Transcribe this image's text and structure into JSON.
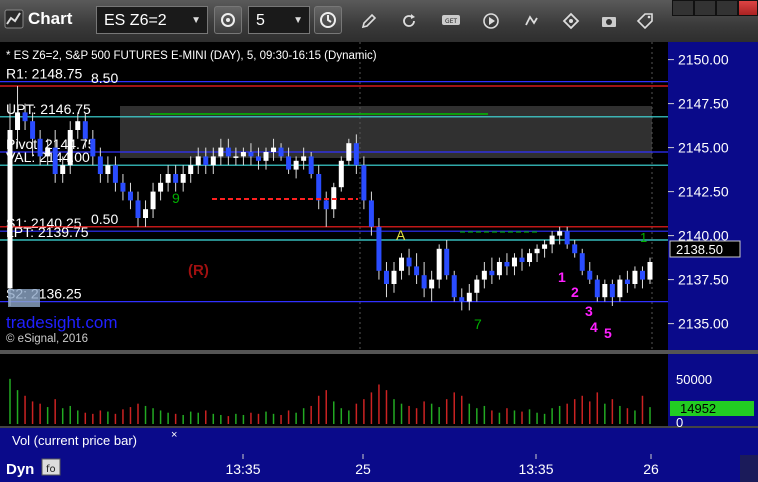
{
  "toolbar": {
    "app_title": "Chart",
    "symbol": "ES Z6=2",
    "interval": "5",
    "icons": [
      "link-icon",
      "interval-clock-icon",
      "pencil-icon",
      "refresh-icon",
      "get-icon",
      "play-icon",
      "diamond-icon",
      "camera-icon",
      "tag-icon"
    ]
  },
  "chart_data": {
    "type": "candlestick",
    "header": "* ES Z6=2, S&P 500 FUTURES E-MINI (DAY), 5, 09:30-16:15 (Dynamic)",
    "ylim": [
      2133.5,
      2151.0
    ],
    "y_ticks": [
      "2150.00",
      "2147.50",
      "2145.00",
      "2142.50",
      "2140.00",
      "2137.50",
      "2135.00"
    ],
    "last_price": "2138.50",
    "x_ticks": [
      "13:35",
      "25",
      "13:35",
      "26"
    ],
    "levels": [
      {
        "label": "R1: 2148.75",
        "value": 2148.75,
        "color": "#3030ff"
      },
      {
        "label": "8.50",
        "value": 2148.5,
        "color": "#ff2020"
      },
      {
        "label": "UPT: 2146.75",
        "value": 2146.75,
        "color": "#40e0e0"
      },
      {
        "label": "Pivot: 2144.75",
        "value": 2144.75,
        "color": "#3030ff"
      },
      {
        "label": "VAL: 2144.00",
        "value": 2144.0,
        "color": "#40e0e0"
      },
      {
        "label": "S1: 2140.25",
        "value": 2140.25,
        "color": "#3030ff"
      },
      {
        "label": "0.50",
        "value": 2140.5,
        "color": "#ff2020"
      },
      {
        "label": "LPT: 2139.75",
        "value": 2139.75,
        "color": "#40e0e0"
      },
      {
        "label": "S2: 2136.25",
        "value": 2136.25,
        "color": "#3030ff"
      }
    ],
    "annotations": {
      "A": "A",
      "R": "(R)",
      "magenta": [
        "1",
        "2",
        "3",
        "4",
        "5"
      ],
      "green_seq": [
        "7",
        "9",
        "1"
      ]
    },
    "watermark": "tradesight.com",
    "copyright": "© eSignal, 2016",
    "volume": {
      "label": "Vol (current price bar)",
      "ticks": [
        "50000",
        "0"
      ],
      "last": "14952"
    },
    "ohlc": [
      [
        2137.0,
        2147.5,
        2136.0,
        2146.0
      ],
      [
        2146.0,
        2148.5,
        2145.0,
        2147.0
      ],
      [
        2147.0,
        2147.5,
        2146.0,
        2146.5
      ],
      [
        2146.5,
        2147.0,
        2144.5,
        2145.5
      ],
      [
        2145.5,
        2146.0,
        2144.0,
        2144.5
      ],
      [
        2144.5,
        2145.5,
        2144.0,
        2145.0
      ],
      [
        2145.0,
        2146.0,
        2143.0,
        2143.5
      ],
      [
        2143.5,
        2144.5,
        2143.0,
        2144.0
      ],
      [
        2144.0,
        2146.5,
        2143.5,
        2146.0
      ],
      [
        2146.0,
        2147.0,
        2145.5,
        2146.5
      ],
      [
        2146.5,
        2147.0,
        2145.0,
        2145.5
      ],
      [
        2145.5,
        2146.0,
        2144.0,
        2144.5
      ],
      [
        2144.5,
        2145.0,
        2143.0,
        2143.5
      ],
      [
        2143.5,
        2144.5,
        2143.0,
        2144.0
      ],
      [
        2144.0,
        2144.5,
        2142.5,
        2143.0
      ],
      [
        2143.0,
        2143.5,
        2142.0,
        2142.5
      ],
      [
        2142.5,
        2143.0,
        2141.5,
        2142.0
      ],
      [
        2142.0,
        2142.5,
        2140.5,
        2141.0
      ],
      [
        2141.0,
        2142.0,
        2140.5,
        2141.5
      ],
      [
        2141.5,
        2143.0,
        2141.0,
        2142.5
      ],
      [
        2142.5,
        2143.5,
        2142.0,
        2143.0
      ],
      [
        2143.0,
        2144.0,
        2142.5,
        2143.5
      ],
      [
        2143.5,
        2144.0,
        2142.5,
        2143.0
      ],
      [
        2143.0,
        2144.0,
        2142.5,
        2143.5
      ],
      [
        2143.5,
        2144.5,
        2143.0,
        2144.0
      ],
      [
        2144.0,
        2145.0,
        2143.5,
        2144.5
      ],
      [
        2144.5,
        2145.0,
        2143.5,
        2144.0
      ],
      [
        2144.0,
        2145.0,
        2143.5,
        2144.5
      ],
      [
        2144.5,
        2145.5,
        2144.0,
        2145.0
      ],
      [
        2145.0,
        2145.5,
        2144.0,
        2144.5
      ],
      [
        2144.5,
        2145.0,
        2144.0,
        2144.5
      ],
      [
        2144.5,
        2145.0,
        2144.0,
        2144.75
      ],
      [
        2144.75,
        2145.25,
        2144.0,
        2144.5
      ],
      [
        2144.5,
        2145.0,
        2143.75,
        2144.25
      ],
      [
        2144.25,
        2145.0,
        2143.75,
        2144.75
      ],
      [
        2144.75,
        2145.5,
        2144.25,
        2145.0
      ],
      [
        2145.0,
        2145.25,
        2144.25,
        2144.5
      ],
      [
        2144.5,
        2145.0,
        2143.5,
        2143.75
      ],
      [
        2143.75,
        2144.5,
        2143.25,
        2144.25
      ],
      [
        2144.25,
        2145.0,
        2143.75,
        2144.5
      ],
      [
        2144.5,
        2144.75,
        2143.25,
        2143.5
      ],
      [
        2143.5,
        2144.0,
        2141.5,
        2142.0
      ],
      [
        2142.0,
        2142.5,
        2140.5,
        2141.5
      ],
      [
        2141.5,
        2143.0,
        2141.0,
        2142.75
      ],
      [
        2142.75,
        2144.5,
        2142.5,
        2144.25
      ],
      [
        2144.25,
        2145.5,
        2144.0,
        2145.25
      ],
      [
        2145.25,
        2145.75,
        2143.5,
        2144.0
      ],
      [
        2144.0,
        2144.5,
        2141.5,
        2142.0
      ],
      [
        2142.0,
        2142.5,
        2140.0,
        2140.5
      ],
      [
        2140.5,
        2141.0,
        2137.5,
        2138.0
      ],
      [
        2138.0,
        2138.5,
        2136.5,
        2137.25
      ],
      [
        2137.25,
        2138.5,
        2136.75,
        2138.0
      ],
      [
        2138.0,
        2139.0,
        2137.5,
        2138.75
      ],
      [
        2138.75,
        2139.25,
        2137.75,
        2138.25
      ],
      [
        2138.25,
        2139.0,
        2137.25,
        2137.75
      ],
      [
        2137.75,
        2138.5,
        2136.5,
        2137.0
      ],
      [
        2137.0,
        2138.0,
        2136.25,
        2137.5
      ],
      [
        2137.5,
        2139.5,
        2137.0,
        2139.25
      ],
      [
        2139.25,
        2139.75,
        2137.5,
        2137.75
      ],
      [
        2137.75,
        2138.0,
        2136.25,
        2136.5
      ],
      [
        2136.5,
        2137.0,
        2135.75,
        2136.25
      ],
      [
        2136.25,
        2137.25,
        2135.75,
        2136.75
      ],
      [
        2136.75,
        2137.75,
        2136.25,
        2137.5
      ],
      [
        2137.5,
        2138.5,
        2137.0,
        2138.0
      ],
      [
        2138.0,
        2138.75,
        2137.25,
        2137.75
      ],
      [
        2137.75,
        2138.75,
        2137.5,
        2138.5
      ],
      [
        2138.5,
        2139.0,
        2137.75,
        2138.25
      ],
      [
        2138.25,
        2139.0,
        2137.75,
        2138.75
      ],
      [
        2138.75,
        2139.25,
        2138.0,
        2138.5
      ],
      [
        2138.5,
        2139.25,
        2138.25,
        2139.0
      ],
      [
        2139.0,
        2139.5,
        2138.5,
        2139.25
      ],
      [
        2139.25,
        2139.75,
        2138.75,
        2139.5
      ],
      [
        2139.5,
        2140.25,
        2139.0,
        2140.0
      ],
      [
        2140.0,
        2140.5,
        2139.5,
        2140.25
      ],
      [
        2140.25,
        2140.5,
        2139.25,
        2139.5
      ],
      [
        2139.5,
        2139.75,
        2138.75,
        2139.0
      ],
      [
        2139.0,
        2139.25,
        2137.75,
        2138.0
      ],
      [
        2138.0,
        2138.5,
        2137.25,
        2137.5
      ],
      [
        2137.5,
        2137.75,
        2136.25,
        2136.5
      ],
      [
        2136.5,
        2137.5,
        2136.25,
        2137.25
      ],
      [
        2137.25,
        2137.5,
        2136.0,
        2136.5
      ],
      [
        2136.5,
        2137.75,
        2136.25,
        2137.5
      ],
      [
        2137.5,
        2138.0,
        2136.75,
        2137.25
      ],
      [
        2137.25,
        2138.25,
        2137.0,
        2138.0
      ],
      [
        2138.0,
        2138.25,
        2137.0,
        2137.5
      ],
      [
        2137.5,
        2138.75,
        2137.25,
        2138.5
      ]
    ],
    "volumes": [
      40000,
      30000,
      25000,
      20000,
      18000,
      15000,
      22000,
      14000,
      16000,
      12000,
      10000,
      9000,
      12000,
      11000,
      9000,
      13000,
      15000,
      18000,
      16000,
      14000,
      12000,
      10000,
      9000,
      8000,
      11000,
      10000,
      12000,
      9000,
      8000,
      7000,
      9000,
      8000,
      10000,
      9000,
      11000,
      9000,
      8000,
      12000,
      10000,
      14000,
      16000,
      25000,
      30000,
      20000,
      14000,
      12000,
      18000,
      22000,
      28000,
      35000,
      30000,
      22000,
      18000,
      16000,
      14000,
      20000,
      18000,
      15000,
      22000,
      28000,
      25000,
      18000,
      14000,
      16000,
      12000,
      10000,
      14000,
      12000,
      11000,
      13000,
      10000,
      9000,
      14000,
      16000,
      18000,
      22000,
      25000,
      20000,
      28000,
      18000,
      22000,
      16000,
      14000,
      12000,
      25000,
      14952
    ]
  }
}
